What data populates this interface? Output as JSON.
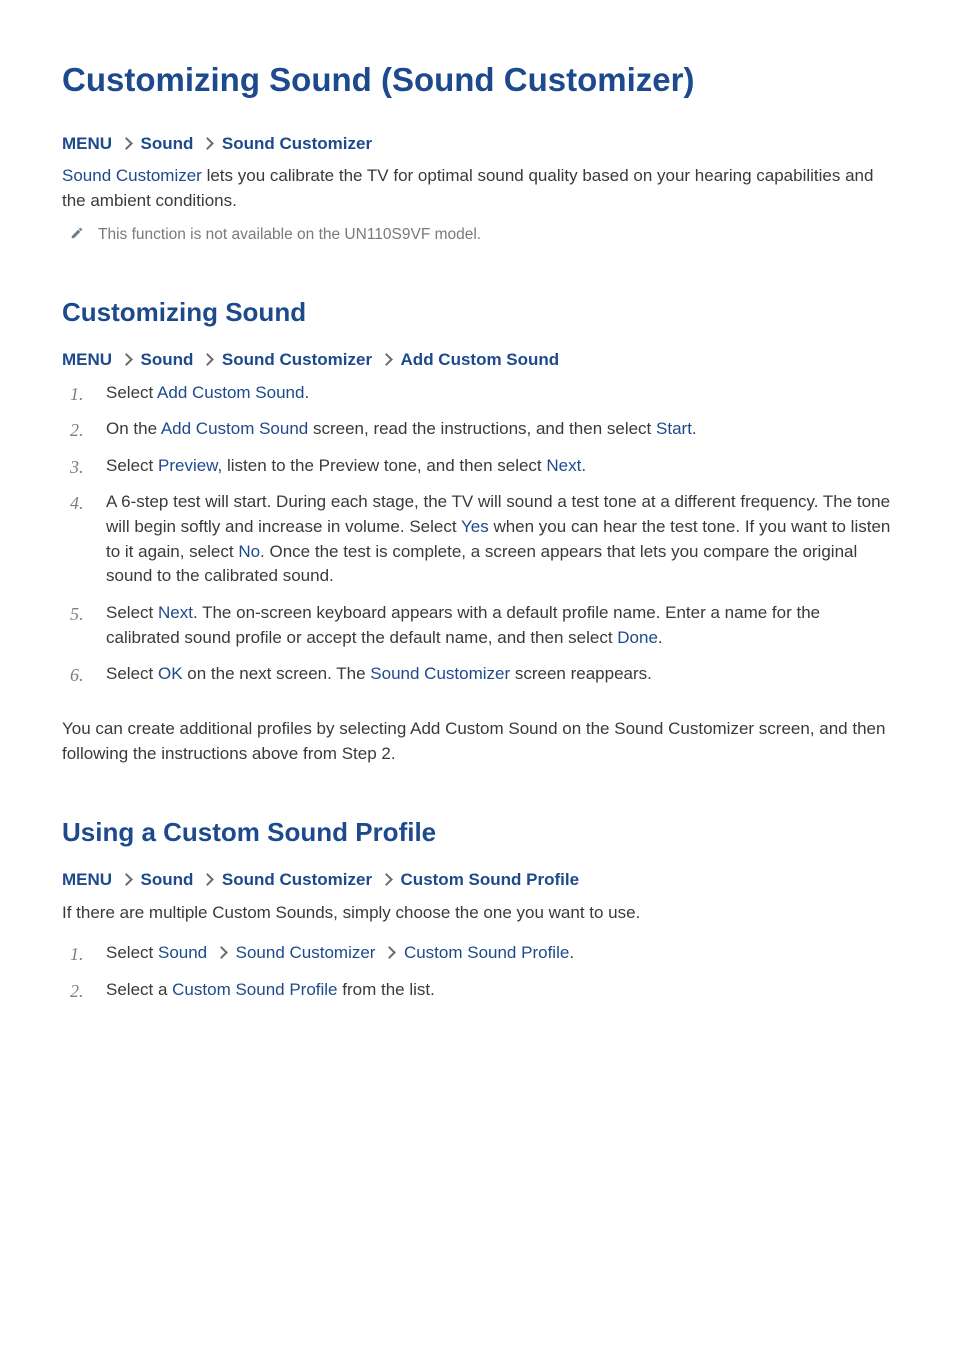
{
  "page": {
    "title": "Customizing Sound (Sound Customizer)"
  },
  "section_intro": {
    "breadcrumb": [
      "MENU",
      "Sound",
      "Sound Customizer"
    ],
    "lead_parts": {
      "term": "Sound Customizer",
      "rest": " lets you calibrate the TV for optimal sound quality based on your hearing capabilities and the ambient conditions."
    },
    "note": "This function is not available on the UN110S9VF model."
  },
  "section_custom": {
    "title": "Customizing Sound",
    "breadcrumb": [
      "MENU",
      "Sound",
      "Sound Customizer",
      "Add Custom Sound"
    ],
    "steps": {
      "i0": {
        "pre": "Select ",
        "t0": "Add Custom Sound",
        "post": "."
      },
      "i1": {
        "pre": "On the ",
        "t0": "Add Custom Sound",
        "mid0": " screen, read the instructions, and then select ",
        "t1": "Start",
        "post": "."
      },
      "i2": {
        "pre": "Select ",
        "t0": "Preview",
        "mid0": ", listen to the Preview tone, and then select ",
        "t1": "Next",
        "post": "."
      },
      "i3": {
        "pre": "A 6-step test will start. During each stage, the TV will sound a test tone at a different frequency. The tone will begin softly and increase in volume. Select ",
        "t0": "Yes",
        "mid0": " when you can hear the test tone. If you want to listen to it again, select ",
        "t1": "No",
        "post": ". Once the test is complete, a screen appears that lets you compare the original sound to the calibrated sound."
      },
      "i4": {
        "pre": "Select ",
        "t0": "Next",
        "mid0": ". The on-screen keyboard appears with a default profile name. Enter a name for the calibrated sound profile or accept the default name, and then select ",
        "t1": "Done",
        "post": "."
      },
      "i5": {
        "pre": "Select ",
        "t0": "OK",
        "mid0": " on the next screen. The ",
        "t1": "Sound Customizer",
        "post": " screen reappears."
      }
    },
    "trailing": "You can create additional profiles by selecting Add Custom Sound on the Sound Customizer screen, and then following the instructions above from Step 2."
  },
  "section_use": {
    "title": "Using a Custom Sound Profile",
    "breadcrumb": [
      "MENU",
      "Sound",
      "Sound Customizer",
      "Custom Sound Profile"
    ],
    "lead": "If there are multiple Custom Sounds, simply choose the one you want to use.",
    "steps": {
      "i0": {
        "pre": "Select ",
        "bci0": "Sound",
        "bci1": "Sound Customizer",
        "bci2": "Custom Sound Profile",
        "post": "."
      },
      "i1": {
        "pre": "Select a ",
        "t0": "Custom Sound Profile",
        "post": " from the list."
      }
    }
  }
}
